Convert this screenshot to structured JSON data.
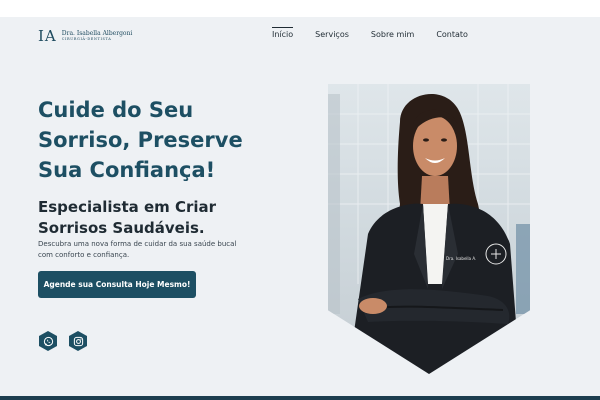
{
  "header": {
    "logo_mark": "IA",
    "logo_name": "Dra. Isabella Albergoni",
    "logo_subtitle": "CIRURGIÃ-DENTISTA",
    "nav": [
      {
        "label": "Início",
        "active": true
      },
      {
        "label": "Serviços",
        "active": false
      },
      {
        "label": "Sobre mim",
        "active": false
      },
      {
        "label": "Contato",
        "active": false
      }
    ]
  },
  "hero": {
    "headline_lines": [
      "Cuide do Seu",
      "Sorriso, Preserve",
      "Sua Confiança!"
    ],
    "subhead_lines": [
      "Especialista em Criar",
      "Sorrisos Saudáveis."
    ],
    "description": "Descubra uma nova forma de cuidar da sua saúde bucal com conforto e confiança.",
    "cta_label": "Agende sua Consulta Hoje Mesmo!"
  },
  "social": [
    {
      "icon": "whatsapp-icon"
    },
    {
      "icon": "instagram-icon"
    }
  ],
  "photo": {
    "badge_text": "Dra. Isabella A.",
    "coat_color": "#1c1f24",
    "brand_color": "#1d4f63"
  }
}
